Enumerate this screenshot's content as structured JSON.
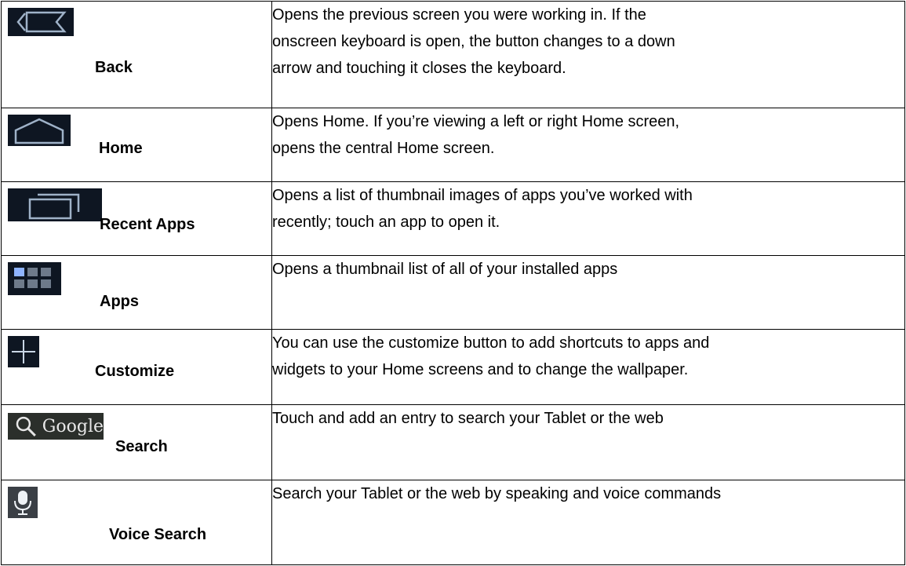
{
  "rows": [
    {
      "label": "Back",
      "icon": "back-icon",
      "lines": [
        "Opens the previous screen you were working in. If the",
        "onscreen keyboard is open, the button changes to a down",
        "arrow and touching it closes the keyboard."
      ]
    },
    {
      "label": "Home",
      "icon": "home-icon",
      "lines": [
        "Opens Home. If you’re viewing a left or right Home screen,",
        "opens the central Home screen."
      ]
    },
    {
      "label": "Recent Apps",
      "icon": "recent-apps-icon",
      "lines": [
        "Opens a list of thumbnail images of apps you’ve worked with",
        "recently; touch an app to open it."
      ]
    },
    {
      "label": "Apps",
      "icon": "apps-grid-icon",
      "lines": [
        "Opens a thumbnail list of all of your installed apps"
      ]
    },
    {
      "label": "Customize",
      "icon": "plus-icon",
      "lines": [
        "You can use the customize button to add shortcuts to apps and",
        "widgets to your Home screens and to change the wallpaper."
      ]
    },
    {
      "label": "Search",
      "icon": "google-search-icon",
      "icon_text": "Google",
      "lines": [
        "Touch and add an entry to search your Tablet or the web"
      ]
    },
    {
      "label": "Voice Search",
      "icon": "microphone-icon",
      "lines": [
        "Search your Tablet or the web by speaking and voice commands"
      ]
    }
  ]
}
